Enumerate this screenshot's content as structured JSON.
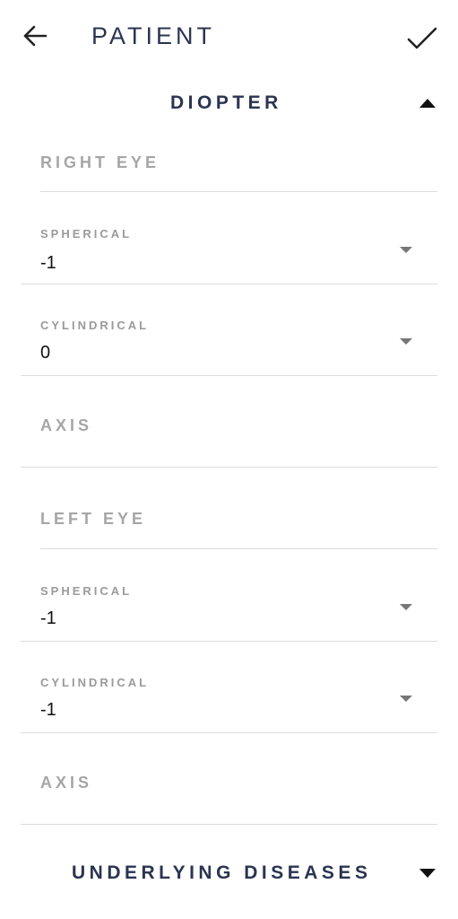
{
  "header": {
    "title": "PATIENT",
    "back_icon": "arrow-left-icon",
    "save_icon": "check-icon"
  },
  "sections": {
    "diopter": {
      "title": "DIOPTER",
      "expanded": true
    },
    "underlying": {
      "title": "UNDERLYING DISEASES",
      "expanded": false
    }
  },
  "right_eye": {
    "label": "RIGHT EYE",
    "spherical": {
      "label": "SPHERICAL",
      "value": "-1"
    },
    "cylindrical": {
      "label": "CYLINDRICAL",
      "value": "0"
    },
    "axis": {
      "label": "AXIS",
      "value": ""
    }
  },
  "left_eye": {
    "label": "LEFT EYE",
    "spherical": {
      "label": "SPHERICAL",
      "value": "-1"
    },
    "cylindrical": {
      "label": "CYLINDRICAL",
      "value": "-1"
    },
    "axis": {
      "label": "AXIS",
      "value": ""
    }
  },
  "colors": {
    "title": "#2b3450",
    "muted_label": "#a6a6a6",
    "divider": "#dcdcdc"
  }
}
